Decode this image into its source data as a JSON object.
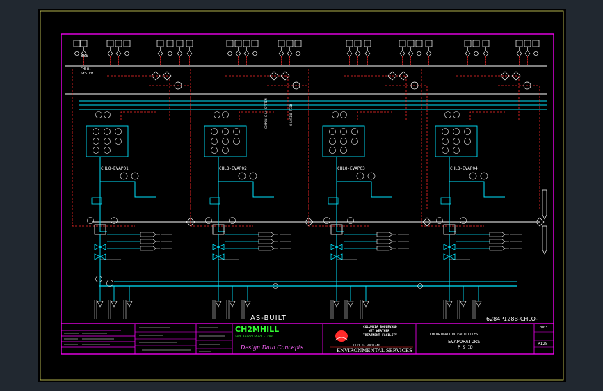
{
  "drawing": {
    "scs_label": "SCS",
    "bus_label": "CHLO-\nSYSTEM",
    "asbuilt": "AS-BUILT",
    "drawing_code": "6284P128B-CHLO-",
    "vertical_tag_1": "COMMON CHLO SYSTEM",
    "vertical_tag_2": "CHLORINE FEED",
    "evaporators": [
      {
        "label": "CHLO-EVAP01"
      },
      {
        "label": "CHLO-EVAP02"
      },
      {
        "label": "CHLO-EVAP03"
      },
      {
        "label": "CHLO-EVAP04"
      }
    ]
  },
  "title_block": {
    "firm_name": "CH2MHILL",
    "firm_sub": "and Associated Firms",
    "design_tag": "Design Data Concepts",
    "owner_line1": "COLUMBIA BOULEVARD",
    "owner_line2": "WET WEATHER",
    "owner_line3": "TREATMENT FACILITY",
    "city": "CITY OF PORTLAND",
    "bureau": "ENVIRONMENTAL SERVICES",
    "facility": "CHLORINATION FACILITIES",
    "sheet_title": "EVAPORATORS",
    "pid": "P & ID",
    "sheet_no": "P128",
    "date": "2003"
  },
  "colors": {
    "border": "#ff00ff",
    "process": "#00e5ff",
    "signal": "#ff2a2a",
    "text": "#ffffff",
    "green": "#33ff33",
    "yellow": "#ffff00"
  }
}
